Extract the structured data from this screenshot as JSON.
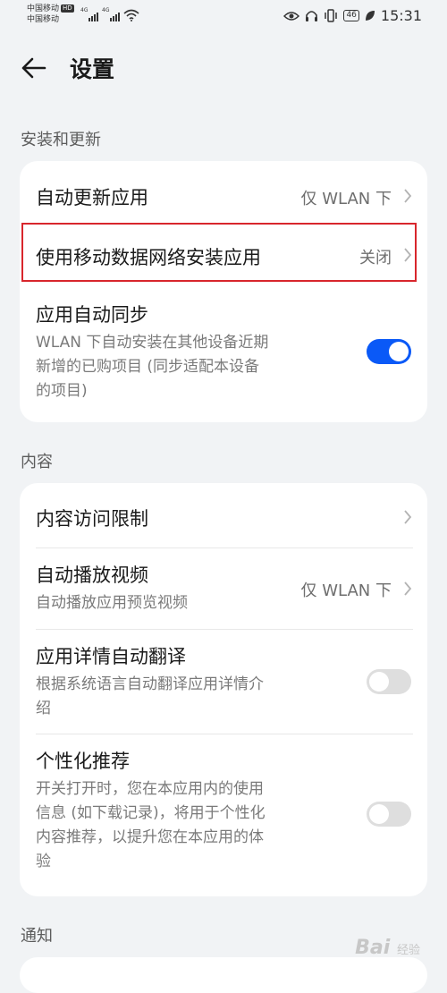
{
  "status_bar": {
    "carrier_1": "中国移动",
    "hd_badge": "HD",
    "carrier_2": "中国移动",
    "net_type_1": "4G",
    "net_type_2": "4G",
    "battery": "46",
    "time": "15:31"
  },
  "header": {
    "title": "设置"
  },
  "sections": {
    "install_update": {
      "label": "安装和更新",
      "auto_update": {
        "title": "自动更新应用",
        "value": "仅 WLAN 下"
      },
      "mobile_data_install": {
        "title": "使用移动数据网络安装应用",
        "value": "关闭"
      },
      "auto_sync": {
        "title": "应用自动同步",
        "sub_1": "WLAN 下自动安装在其他设备近期",
        "sub_2": "新增的已购项目 (同步适配本设备",
        "sub_3": "的项目)",
        "enabled": true
      }
    },
    "content": {
      "label": "内容",
      "access_limit": {
        "title": "内容访问限制"
      },
      "autoplay": {
        "title": "自动播放视频",
        "sub": "自动播放应用预览视频",
        "value": "仅 WLAN 下"
      },
      "auto_translate": {
        "title": "应用详情自动翻译",
        "sub_1": "根据系统语言自动翻译应用详情介",
        "sub_2": "绍",
        "enabled": false
      },
      "personalized": {
        "title": "个性化推荐",
        "sub_1": "开关打开时，您在本应用内的使用",
        "sub_2": "信息 (如下载记录)，将用于个性化",
        "sub_3": "内容推荐，以提升您在本应用的体",
        "sub_4": "验",
        "enabled": false
      }
    },
    "notify": {
      "label": "通知"
    }
  },
  "watermark": {
    "text": "Bai",
    "sub": "经验"
  },
  "colors": {
    "background": "#f1f3f5",
    "accent": "#0a59f7",
    "highlight_border": "#d8262c"
  }
}
